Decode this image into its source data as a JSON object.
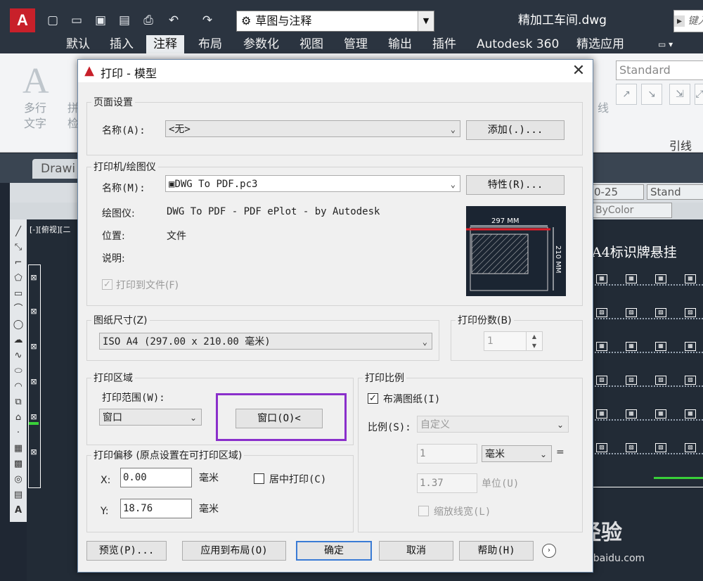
{
  "titlebar": {
    "workspace": "草图与注释",
    "document": "精加工车间.dwg",
    "search_placeholder": "键入",
    "logo": "A"
  },
  "ribbon": {
    "tabs": [
      "默认",
      "插入",
      "注释",
      "布局",
      "参数化",
      "视图",
      "管理",
      "输出",
      "插件",
      "Autodesk 360",
      "精选应用"
    ],
    "active_tab": "注释",
    "multiline_text": [
      "多行",
      "文字"
    ],
    "check_text": [
      "拼",
      "检"
    ],
    "leader_label": "线",
    "style_value": "Standard",
    "panel_label": "引线"
  },
  "drawing": {
    "tab": "Drawi",
    "view_label": "[-][俯视][二",
    "layer_value": "0-25",
    "style_value": "Stand",
    "color_value": "ByColor",
    "canvas_title": "A4标识牌悬挂"
  },
  "dialog": {
    "title": "打印 - 模型",
    "page_setup": {
      "legend": "页面设置",
      "name_label": "名称(A):",
      "name_value": "<无>",
      "add_button": "添加(.)..."
    },
    "printer": {
      "legend": "打印机/绘图仪",
      "name_label": "名称(M):",
      "name_value": "DWG To PDF.pc3",
      "properties_button": "特性(R)...",
      "plotter_label": "绘图仪:",
      "plotter_value": "DWG To PDF - PDF ePlot - by Autodesk",
      "location_label": "位置:",
      "location_value": "文件",
      "description_label": "说明:",
      "print_to_file": "打印到文件(F)",
      "print_to_file_checked": true,
      "preview_width": "297 MM",
      "preview_height": "210 MM"
    },
    "paper_size": {
      "legend": "图纸尺寸(Z)",
      "value": "ISO A4 (297.00 x 210.00 毫米)"
    },
    "copies": {
      "legend": "打印份数(B)",
      "value": "1"
    },
    "plot_area": {
      "legend": "打印区域",
      "range_label": "打印范围(W):",
      "range_value": "窗口",
      "window_button": "窗口(O)<"
    },
    "plot_offset": {
      "legend": "打印偏移 (原点设置在可打印区域)",
      "x_label": "X:",
      "x_value": "0.00",
      "x_unit": "毫米",
      "y_label": "Y:",
      "y_value": "18.76",
      "y_unit": "毫米",
      "center_label": "居中打印(C)",
      "center_checked": false
    },
    "plot_scale": {
      "legend": "打印比例",
      "fit_label": "布满图纸(I)",
      "fit_checked": true,
      "scale_label": "比例(S):",
      "scale_value": "自定义",
      "value1": "1",
      "unit_value": "毫米",
      "equals": "=",
      "value2": "1.37",
      "unit_label": "单位(U)",
      "lineweight_label": "缩放线宽(L)"
    },
    "buttons": {
      "preview": "预览(P)...",
      "apply": "应用到布局(O)",
      "ok": "确定",
      "cancel": "取消",
      "help": "帮助(H)"
    }
  },
  "watermark": {
    "brand": "Bai 经验",
    "url": "jingyan.baidu.com"
  }
}
